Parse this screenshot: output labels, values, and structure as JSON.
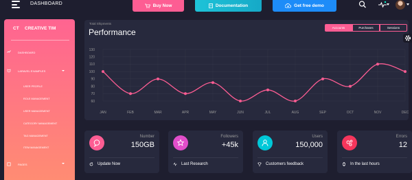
{
  "navbar": {
    "title": "DASHBOARD",
    "buy_label": "Buy Now",
    "doc_label": "Documentation",
    "free_label": "Get free demo"
  },
  "sidebar": {
    "logo_mini": "CT",
    "logo_name": "CREATIVE TIM",
    "items": [
      {
        "label": "DASHBOARD",
        "icon": "dashboard-icon"
      },
      {
        "label": "LARAVEL EXAMPLES",
        "icon": "laravel-icon"
      },
      {
        "label": "USER PROFILE"
      },
      {
        "label": "ROLE MANAGEMENT"
      },
      {
        "label": "USER MANAGEMENT"
      },
      {
        "label": "CATEGORY MANAGEMENT"
      },
      {
        "label": "TAG MANAGEMENT"
      },
      {
        "label": "ITEM MANAGEMENT"
      },
      {
        "label": "PAGES",
        "icon": "pages-icon"
      }
    ]
  },
  "chart_card": {
    "subtitle": "Total Shipments",
    "title": "Performance",
    "tabs": [
      "Accounts",
      "Purchases",
      "Sessions"
    ],
    "active_tab": "Accounts"
  },
  "chart_data": {
    "type": "line",
    "categories": [
      "JAN",
      "FEB",
      "MAR",
      "APR",
      "MAY",
      "JUN",
      "JUL",
      "AUG",
      "SEP",
      "OCT",
      "NOV",
      "DEC"
    ],
    "series": [
      {
        "values": [
          100,
          70,
          90,
          70,
          85,
          60,
          75,
          60,
          90,
          80,
          110,
          100
        ]
      }
    ],
    "y_ticks": [
      60,
      70,
      80,
      90,
      100,
      110,
      120,
      130
    ],
    "ylim": [
      60,
      130
    ],
    "grid": true,
    "line_color": "#fd5d93"
  },
  "stats": [
    {
      "label": "Number",
      "value": "150GB",
      "footer": "Update Now",
      "color": "#fd5d93",
      "icon": "chat-icon",
      "footer_icon": "refresh-icon"
    },
    {
      "label": "Followers",
      "value": "+45k",
      "footer": "Last Research",
      "color": "#e14eca",
      "icon": "star-icon",
      "footer_icon": "sound-wave-icon"
    },
    {
      "label": "Users",
      "value": "150,000",
      "footer": "Customers feedback",
      "color": "#00f2c3",
      "icon": "user-icon",
      "footer_icon": "trophy-icon"
    },
    {
      "label": "Errors",
      "value": "12",
      "footer": "In the last hours",
      "color": "#fd5d93",
      "icon": "molecule-icon",
      "footer_icon": "watch-icon"
    }
  ]
}
